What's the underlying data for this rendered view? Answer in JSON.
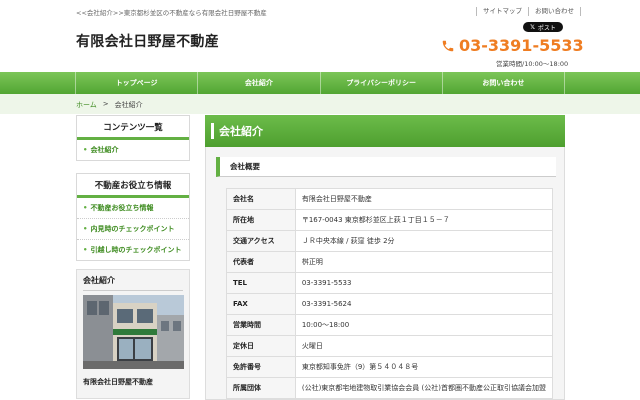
{
  "header": {
    "tagline": "<<会社紹介>>東京都杉並区の不動産なら有限会社日野屋不動産",
    "site_title": "有限会社日野屋不動産",
    "util_links": [
      "サイトマップ",
      "お問い合わせ"
    ],
    "x_post": "ポスト",
    "phone": "03-3391-5533",
    "hours": "営業時間/10:00〜18:00"
  },
  "nav": {
    "items": [
      "トップページ",
      "会社紹介",
      "プライバシーポリシー",
      "お問い合わせ"
    ]
  },
  "breadcrumb": {
    "home": "ホーム",
    "separator": ">",
    "current": "会社紹介"
  },
  "sidebar": {
    "contents_title": "コンテンツ一覧",
    "contents_items": [
      "会社紹介"
    ],
    "info_title": "不動産お役立ち情報",
    "info_items": [
      "不動産お役立ち情報",
      "内見時のチェックポイント",
      "引越し時のチェックポイント"
    ],
    "company_title": "会社紹介",
    "company_name": "有限会社日野屋不動産"
  },
  "main": {
    "title": "会社紹介",
    "section_title": "会社概要",
    "rows": [
      {
        "key": "会社名",
        "value": "有限会社日野屋不動産"
      },
      {
        "key": "所在地",
        "value": "〒167-0043 東京都杉並区上荻１丁目１５－７"
      },
      {
        "key": "交通アクセス",
        "value": "ＪＲ中央本線 / 荻窪 徒歩 2分"
      },
      {
        "key": "代表者",
        "value": "桝正明"
      },
      {
        "key": "TEL",
        "value": "03-3391-5533"
      },
      {
        "key": "FAX",
        "value": "03-3391-5624"
      },
      {
        "key": "営業時間",
        "value": "10:00〜18:00"
      },
      {
        "key": "定休日",
        "value": "火曜日"
      },
      {
        "key": "免許番号",
        "value": "東京都知事免許（9）第５４０４８号"
      },
      {
        "key": "所属団体",
        "value": "(公社)東京都宅地建物取引業協会会員 (公社)首都圏不動産公正取引協議会加盟"
      }
    ]
  },
  "colors": {
    "accent_green": "#63b043",
    "phone_orange": "#ef7d22"
  }
}
